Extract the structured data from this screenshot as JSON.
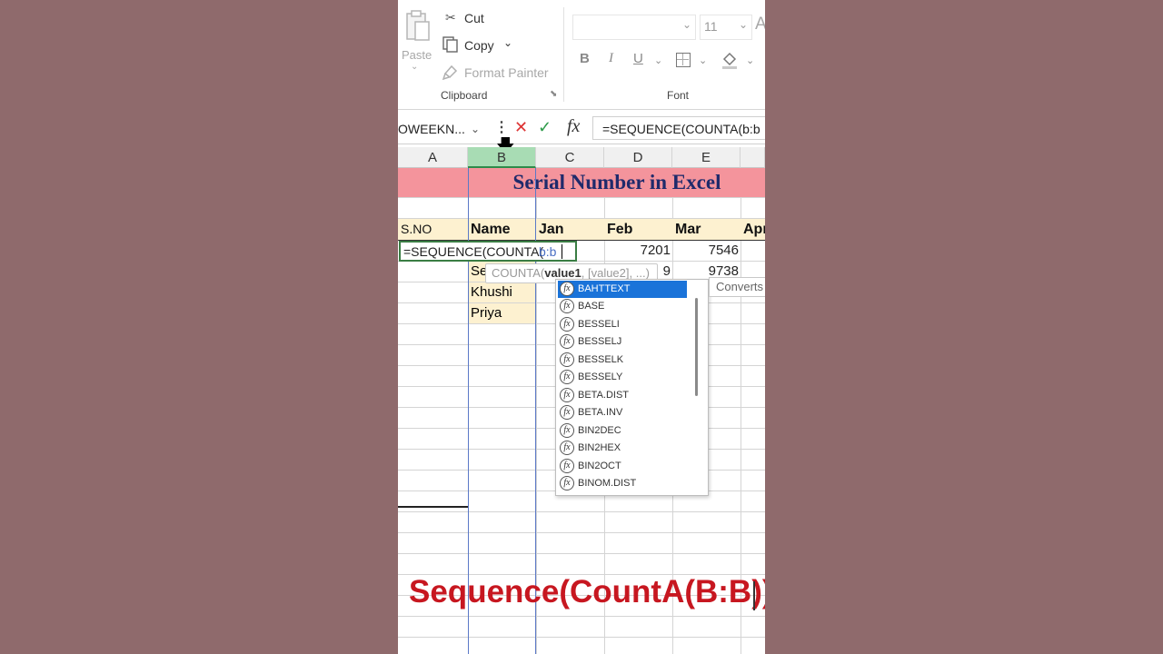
{
  "ribbon": {
    "paste": "Paste",
    "cut": "Cut",
    "copy": "Copy",
    "format_painter": "Format Painter",
    "clipboard_group": "Clipboard",
    "font_group": "Font",
    "font_size": "11",
    "font_size_extra": "A",
    "bold": "B",
    "italic": "I",
    "underline": "U"
  },
  "formula_bar": {
    "name_box": "OWEEKN...",
    "formula": "=SEQUENCE(COUNTA(b:b"
  },
  "grid": {
    "columns": [
      "A",
      "B",
      "C",
      "D",
      "E"
    ],
    "title": "Serial Number in Excel",
    "headers": [
      "S.NO",
      "Name",
      "Jan",
      "Feb",
      "Mar",
      "Apr"
    ],
    "active_cell_text": "=SEQUENCE(COUNTA(",
    "active_cell_ref": "b:b",
    "row1_feb": "7201",
    "row1_mar": "7546",
    "row2_name_partial": "Se",
    "row2_feb_partial": "9",
    "row2_mar": "9738",
    "names": [
      "Khushi",
      "Priya"
    ]
  },
  "autocomplete": {
    "tooltip_fn": "COUNTA(",
    "tooltip_arg1": "value1",
    "tooltip_rest": ", [value2], ...)",
    "description": "Converts",
    "items": [
      "BAHTTEXT",
      "BASE",
      "BESSELI",
      "BESSELJ",
      "BESSELK",
      "BESSELY",
      "BETA.DIST",
      "BETA.INV",
      "BIN2DEC",
      "BIN2HEX",
      "BIN2OCT",
      "BINOM.DIST"
    ],
    "selected_index": 0
  },
  "caption": "Sequence(CountA(B:B))",
  "colors": {
    "title_band": "#f4949c",
    "header_fill": "#fdf1d0",
    "title_text": "#1f2a6b",
    "caption": "#c71720",
    "selected_item": "#1a73d9",
    "column_b_header": "#a8dcb4"
  }
}
